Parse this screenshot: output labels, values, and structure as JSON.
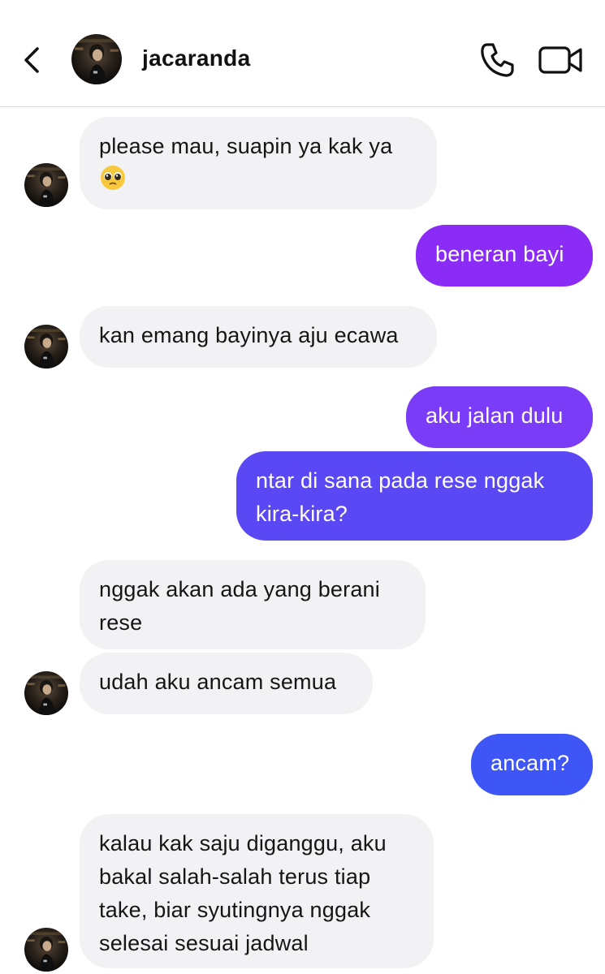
{
  "header": {
    "contact_name": "jacaranda",
    "back_icon": "chevron-left-icon",
    "call_icon": "phone-icon",
    "video_icon": "video-camera-icon"
  },
  "colors": {
    "incoming_bubble": "#f2f2f4",
    "outgoing_gradient": [
      "#8a2cf5",
      "#7a3cf6",
      "#5a48f4",
      "#3f56f6"
    ]
  },
  "messages": [
    {
      "from": "them",
      "lines": [
        "please mau, suapin ya kak ya"
      ],
      "emoji": "pleading-face-emoji"
    },
    {
      "from": "me",
      "lines": [
        "beneran bayi"
      ]
    },
    {
      "from": "them",
      "lines": [
        "kan emang bayinya aju ecawa"
      ]
    },
    {
      "from": "me",
      "lines": [
        "aku jalan dulu"
      ]
    },
    {
      "from": "me",
      "lines": [
        "ntar di sana pada rese nggak",
        "kira-kira?"
      ]
    },
    {
      "from": "them",
      "lines": [
        "nggak akan ada yang berani",
        "rese"
      ]
    },
    {
      "from": "them",
      "lines": [
        "udah aku ancam semua"
      ]
    },
    {
      "from": "me",
      "lines": [
        "ancam?"
      ]
    },
    {
      "from": "them",
      "lines": [
        "kalau kak saju diganggu, aku",
        "bakal salah-salah terus tiap",
        "take, biar syutingnya nggak",
        "selesai sesuai jadwal"
      ]
    }
  ]
}
